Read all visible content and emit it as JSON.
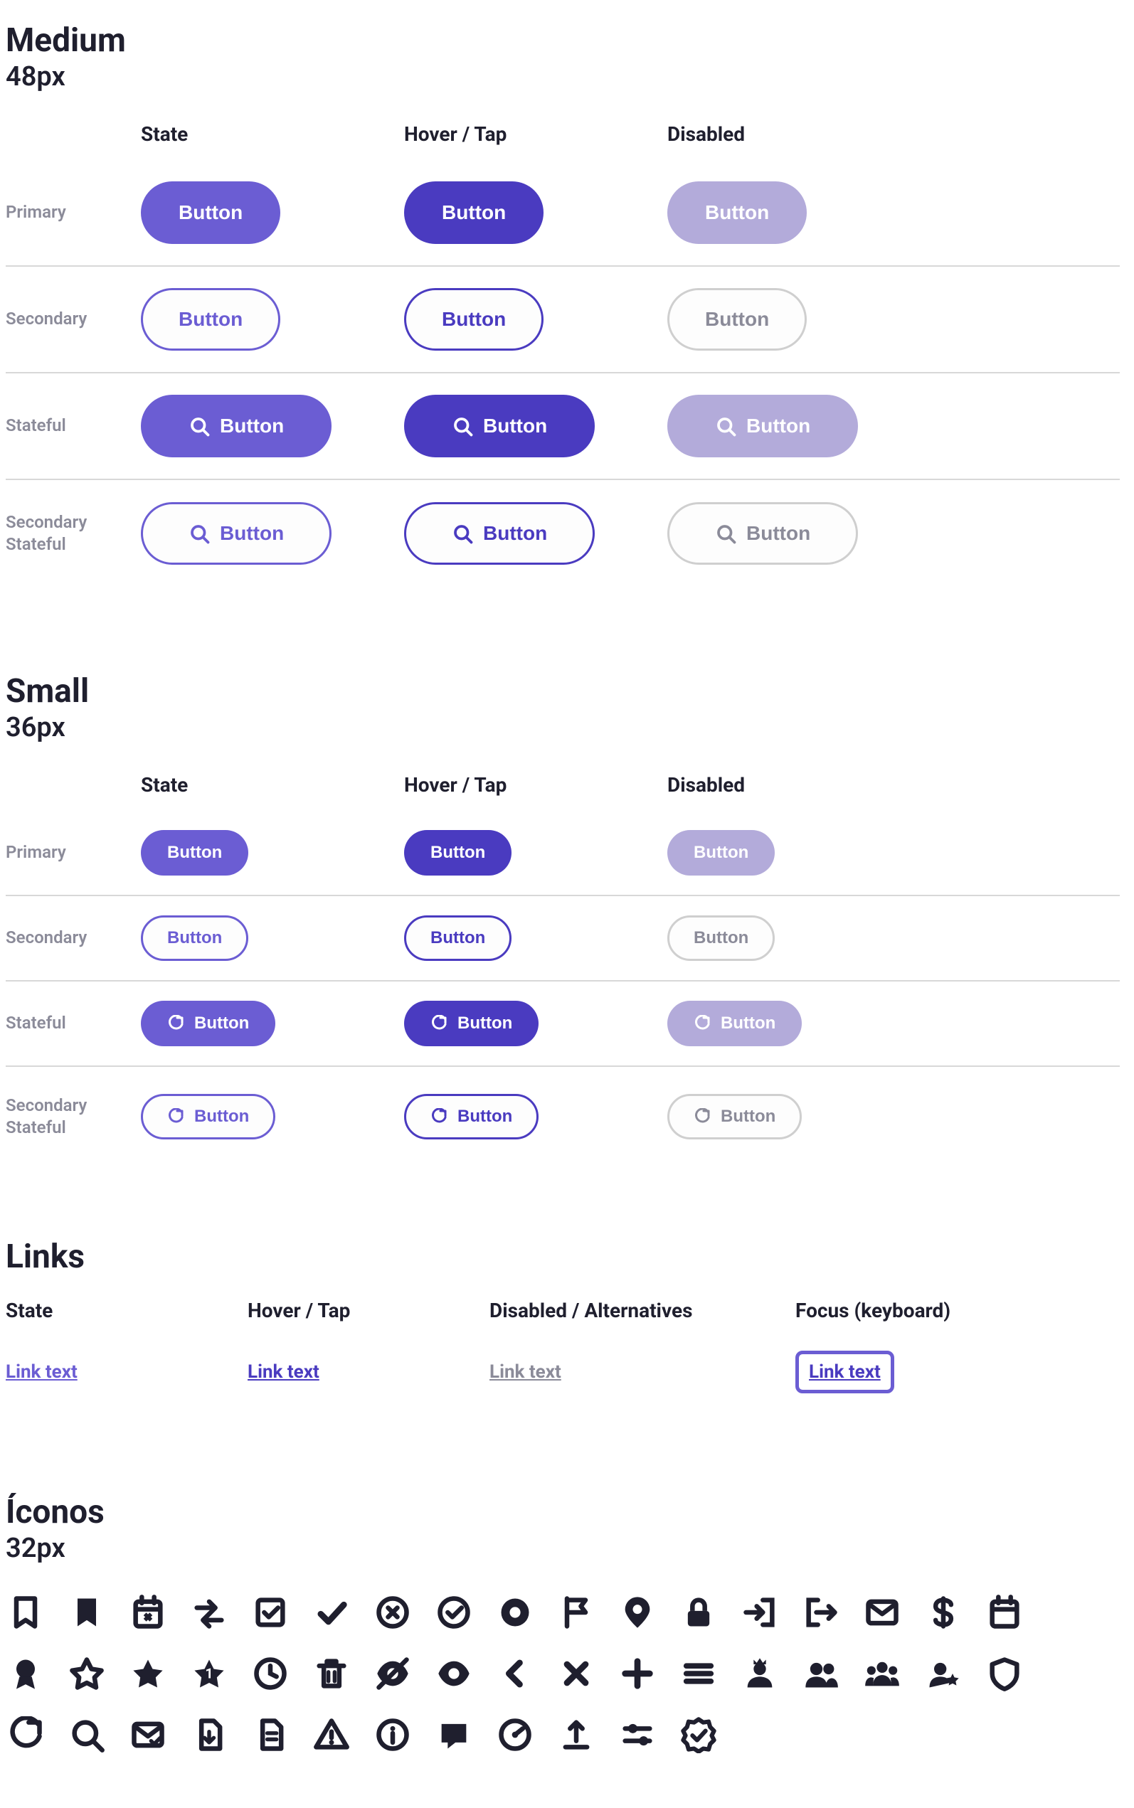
{
  "sections": {
    "medium": {
      "title": "Medium",
      "size_label": "48px"
    },
    "small": {
      "title": "Small",
      "size_label": "36px"
    },
    "links": {
      "title": "Links"
    },
    "icons": {
      "title": "Íconos",
      "size_label": "32px"
    }
  },
  "button_columns": {
    "c1": "State",
    "c2": "Hover / Tap",
    "c3": "Disabled"
  },
  "button_rows": {
    "primary": "Primary",
    "secondary": "Secondary",
    "stateful": "Stateful",
    "secondary_stateful": "Secondary Stateful"
  },
  "button_label": "Button",
  "link_columns": {
    "c1": "State",
    "c2": "Hover / Tap",
    "c3": "Disabled / Alternatives",
    "c4": "Focus (keyboard)"
  },
  "link_label": "Link text",
  "icons": [
    "bookmark-outline",
    "bookmark-filled",
    "calendar-x",
    "swap-horizontal",
    "checkbox",
    "check",
    "x-circle",
    "check-circle",
    "circle-dot",
    "flag",
    "map-pin",
    "lock",
    "login",
    "logout",
    "mail",
    "dollar",
    "calendar",
    "award",
    "star-outline",
    "star-filled",
    "star-badge",
    "clock",
    "trash",
    "eye-off",
    "eye",
    "chevron-left",
    "x",
    "plus",
    "menu",
    "user-crown",
    "users",
    "users-group",
    "user-star",
    "shield",
    "refresh",
    "search",
    "envelope-check",
    "document-arrow",
    "document-lines",
    "warning-triangle",
    "info-circle",
    "chat",
    "meter",
    "upload",
    "sliders",
    "badge-check"
  ],
  "colors": {
    "primary": "#6B5DD3",
    "primary_hover": "#4A3BC0",
    "primary_disabled": "#B3ABDA",
    "text": "#1F1F2E",
    "muted": "#8B8B99"
  }
}
